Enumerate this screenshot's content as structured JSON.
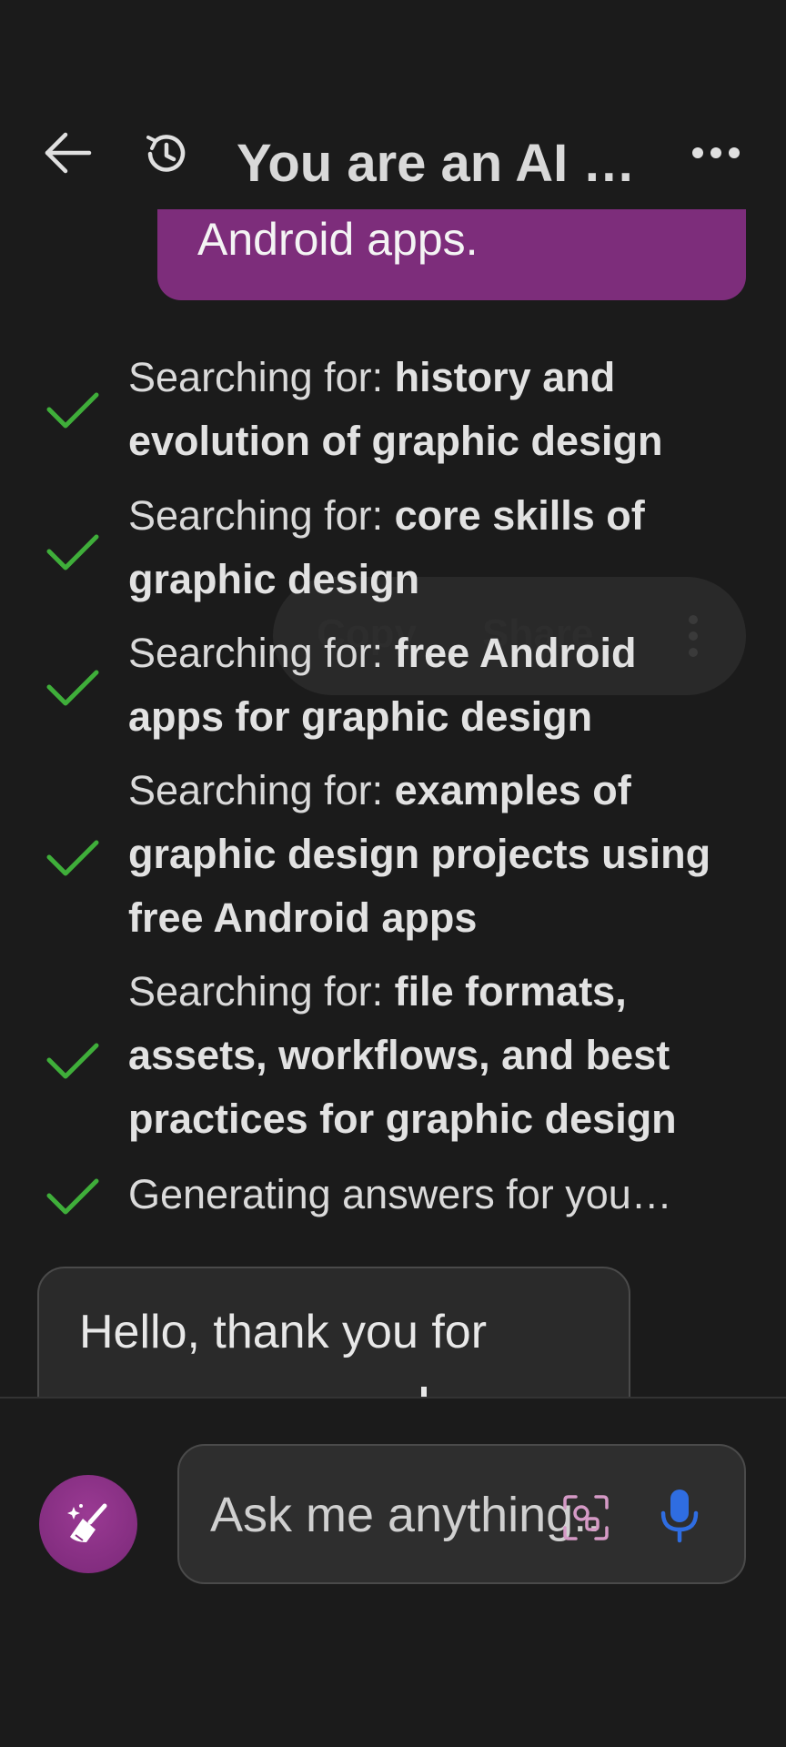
{
  "header": {
    "title": "You are an AI …",
    "back_icon": "back-arrow-icon",
    "history_icon": "history-icon",
    "more_icon": "more-horizontal-icon"
  },
  "user_message": {
    "text": "Android apps.",
    "bubble_color": "#7d2d7b"
  },
  "steps": [
    {
      "prefix": "Searching for: ",
      "query_line1": "history and",
      "query_line2": "evolution of graphic design",
      "query_line3": ""
    },
    {
      "prefix": "Searching for: ",
      "query_line1": "core skills of",
      "query_line2": "graphic design",
      "query_line3": ""
    },
    {
      "prefix": "Searching for: ",
      "query_line1": "free Android",
      "query_line2": "apps for graphic design",
      "query_line3": ""
    },
    {
      "prefix": "Searching for: ",
      "query_line1": "examples of",
      "query_line2": "graphic design projects using",
      "query_line3": "free Android apps"
    },
    {
      "prefix": "Searching for: ",
      "query_line1": "file formats,",
      "query_line2": "assets, workflows, and best",
      "query_line3": "practices for graphic design"
    },
    {
      "prefix": "Generating answers for you…",
      "query_line1": "",
      "query_line2": "",
      "query_line3": ""
    }
  ],
  "check_color": "#3fae3a",
  "context_menu": {
    "copy_label": "Copy",
    "share_label": "Share"
  },
  "bot_message": {
    "text": "Hello, thank you for"
  },
  "input": {
    "placeholder": "Ask me anything..."
  },
  "colors": {
    "background": "#1b1b1b",
    "mic": "#2f6de1",
    "broom_button": "#8a3086"
  }
}
